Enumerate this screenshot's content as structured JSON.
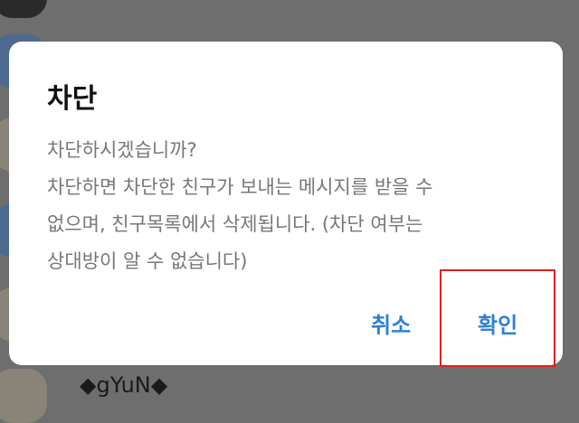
{
  "background_list": {
    "visible_name": "◆gYuN◆"
  },
  "dialog": {
    "title": "차단",
    "message_lines": [
      "차단하시겠습니까?",
      "차단하면 차단한 친구가 보내는 메시지를 받을 수",
      "없으며, 친구목록에서 삭제됩니다. (차단 여부는",
      "상대방이 알 수 없습니다)"
    ],
    "cancel_label": "취소",
    "confirm_label": "확인"
  },
  "colors": {
    "accent": "#2f7fd6",
    "highlight_box": "#e02020",
    "overlay": "#6e6e6e"
  }
}
